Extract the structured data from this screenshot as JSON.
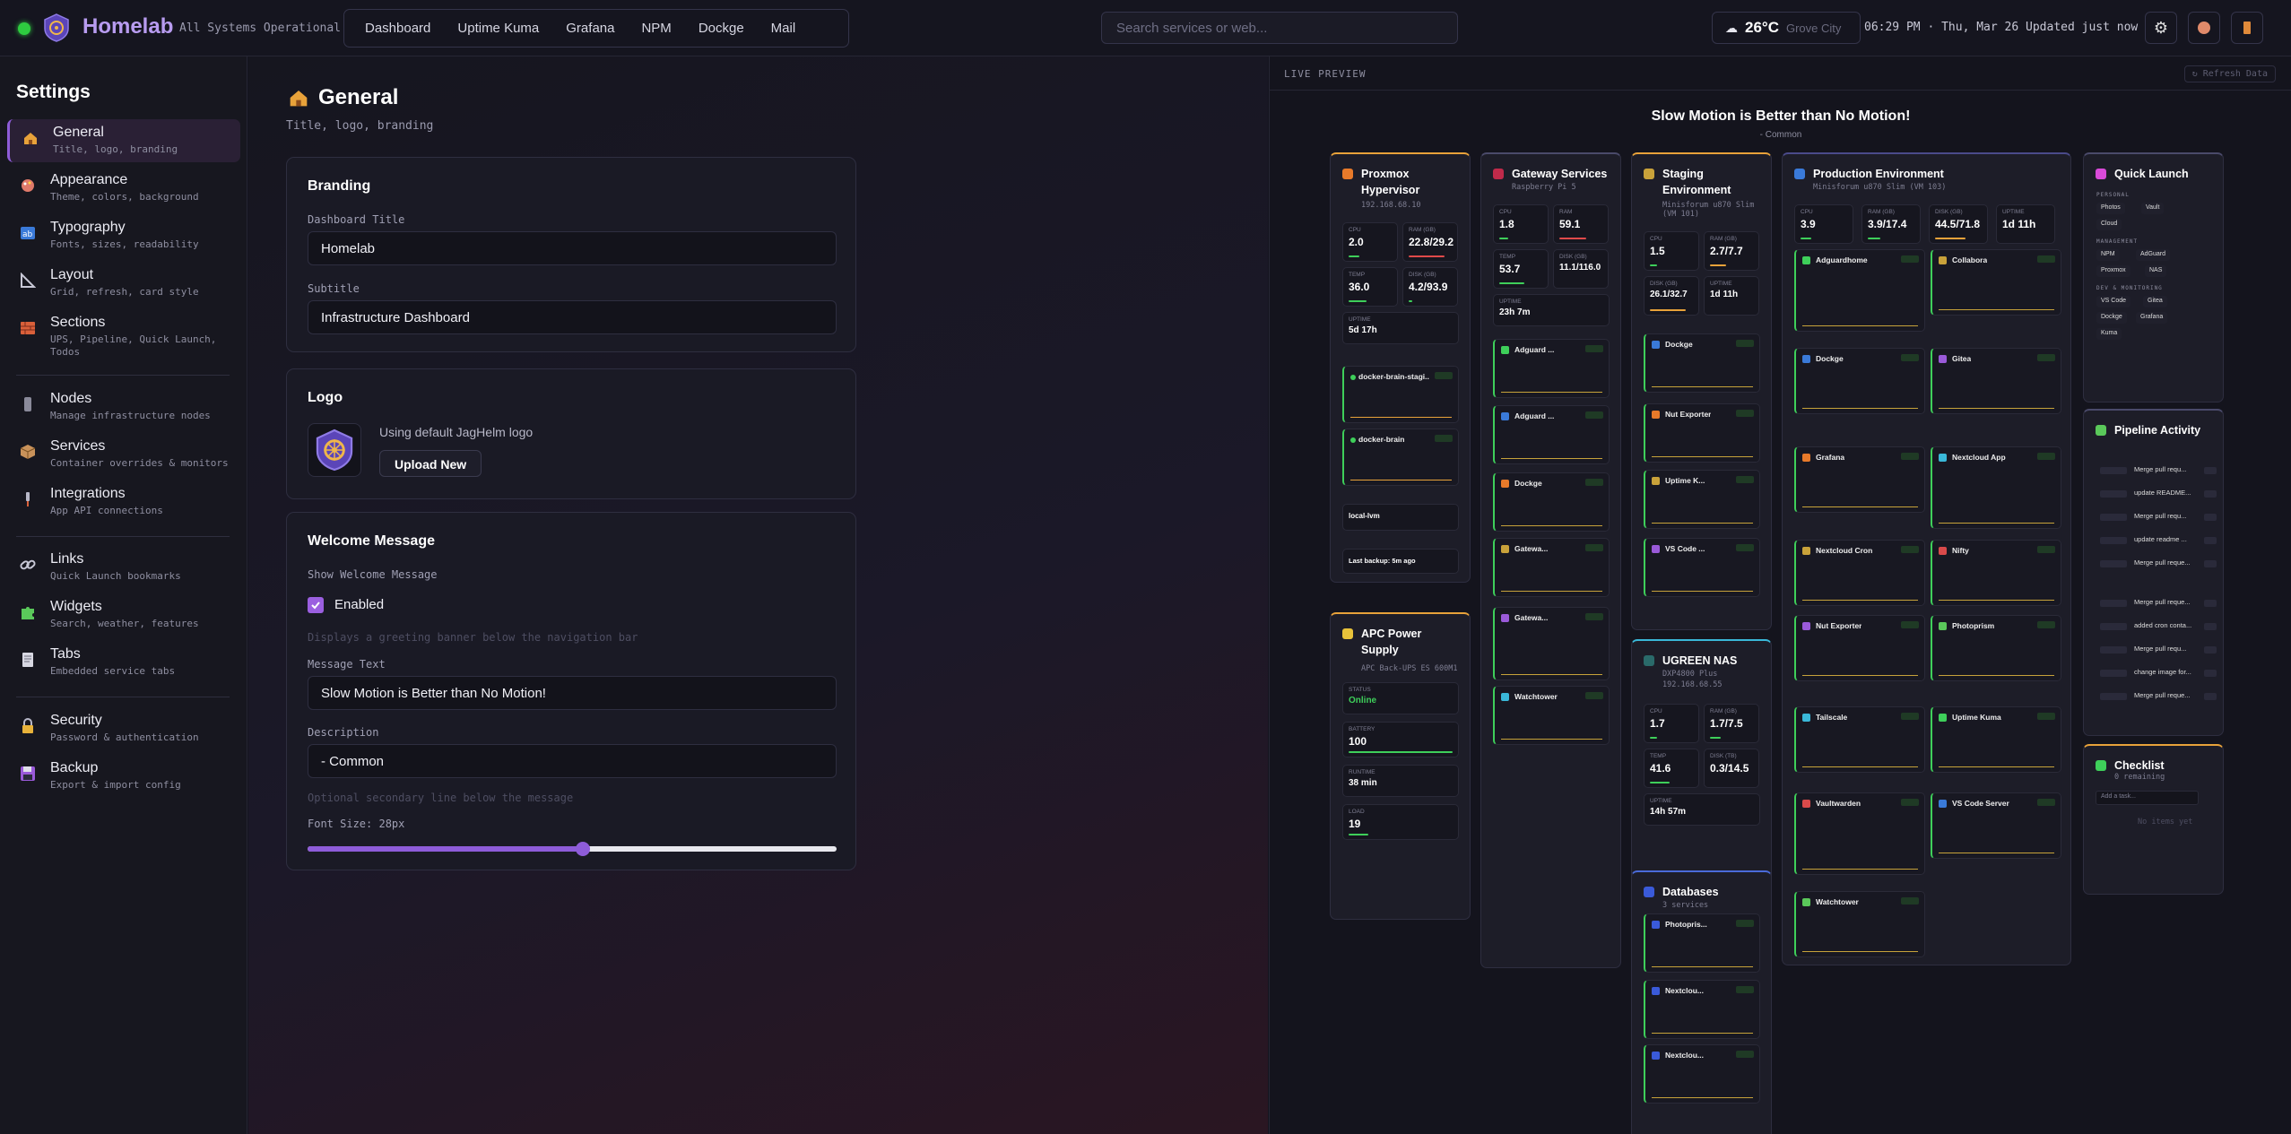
{
  "header": {
    "title": "Homelab",
    "status": "All Systems Operational",
    "nav": [
      "Dashboard",
      "Uptime Kuma",
      "Grafana",
      "NPM",
      "Dockge",
      "Mail"
    ],
    "search_placeholder": "Search services or web...",
    "weather_temp": "26°C",
    "weather_city": "Grove City",
    "clock": "06:29 PM · Thu, Mar 26  Updated just now"
  },
  "sidebar": {
    "title": "Settings",
    "items": [
      {
        "label": "General",
        "desc": "Title, logo, branding"
      },
      {
        "label": "Appearance",
        "desc": "Theme, colors, background"
      },
      {
        "label": "Typography",
        "desc": "Fonts, sizes, readability"
      },
      {
        "label": "Layout",
        "desc": "Grid, refresh, card style"
      },
      {
        "label": "Sections",
        "desc": "UPS, Pipeline, Quick Launch,",
        "desc2": "Todos"
      },
      {
        "label": "Nodes",
        "desc": "Manage infrastructure nodes"
      },
      {
        "label": "Services",
        "desc": "Container overrides & monitors"
      },
      {
        "label": "Integrations",
        "desc": "App API connections"
      },
      {
        "label": "Links",
        "desc": "Quick Launch bookmarks"
      },
      {
        "label": "Widgets",
        "desc": "Search, weather, features"
      },
      {
        "label": "Tabs",
        "desc": "Embedded service tabs"
      },
      {
        "label": "Security",
        "desc": "Password & authentication"
      },
      {
        "label": "Backup",
        "desc": "Export & import config"
      }
    ]
  },
  "main": {
    "title": "General",
    "subtitle": "Title, logo, branding",
    "branding": {
      "heading": "Branding",
      "title_label": "Dashboard Title",
      "title_value": "Homelab",
      "subtitle_label": "Subtitle",
      "subtitle_value": "Infrastructure Dashboard"
    },
    "logo": {
      "heading": "Logo",
      "text": "Using default JagHelm logo",
      "upload": "Upload New"
    },
    "welcome": {
      "heading": "Welcome Message",
      "show_label": "Show Welcome Message",
      "enabled_label": "Enabled",
      "enabled": true,
      "show_hint": "Displays a greeting banner below the navigation bar",
      "message_label": "Message Text",
      "message_value": "Slow Motion is Better than No Motion!",
      "desc_label": "Description",
      "desc_value": "- Common",
      "desc_hint": "Optional secondary line below the message",
      "font_label": "Font Size: 28px",
      "font_fraction": 0.52
    }
  },
  "preview": {
    "label": "LIVE PREVIEW",
    "refresh": "↻ Refresh Data",
    "welcome": "Slow Motion is Better than No Motion!",
    "welcome_desc": "- Common",
    "cards": {
      "proxmox": {
        "title": "Proxmox Hypervisor",
        "ip": "192.168.68.10",
        "cpu": "2.0",
        "ram": "22.8/29.2",
        "temp": "36.0",
        "disk": "4.2/93.9",
        "uptime": "5d 17h",
        "vm1": "docker-brain-stagi...",
        "vm2": "docker-brain",
        "lvm": "local-lvm",
        "backup": "Last backup: 5m ago"
      },
      "gateway": {
        "title": "Gateway Services",
        "sub": "Raspberry Pi 5",
        "cpu": "1.8",
        "ram": "59.1",
        "temp": "53.7",
        "disk": "11.1/116.0",
        "uptime": "23h 7m"
      },
      "staging": {
        "title": "Staging Environment",
        "sub": "Minisforum u870 Slim (VM 101)",
        "cpu": "1.5",
        "ram": "2.7/7.7",
        "disk": "26.1/32.7",
        "uptime": "1d 11h"
      },
      "production": {
        "title": "Production Environment",
        "sub": "Minisforum u870 Slim (VM 103)",
        "cpu": "3.9",
        "ram": "3.9/17.4",
        "disk": "44.5/71.8",
        "uptime": "1d 11h"
      },
      "quick": {
        "title": "Quick Launch",
        "personal": "PERSONAL",
        "management": "MANAGEMENT",
        "dev": "DEV & MONITORING",
        "chips": [
          "Photos",
          "Vault",
          "Cloud",
          "NPM",
          "AdGuard",
          "Proxmox",
          "NAS",
          "VS Code",
          "Gitea",
          "Dockge",
          "Grafana",
          "Kuma"
        ]
      },
      "pipeline": {
        "title": "Pipeline Activity",
        "rows": [
          "Merge pull requ...",
          "update README...",
          "Merge pull requ...",
          "update readme ...",
          "Merge pull reque...",
          "Merge pull reque...",
          "added cron conta...",
          "Merge pull requ...",
          "change image for...",
          "Merge pull reque..."
        ]
      },
      "checklist": {
        "title": "Checklist",
        "sub": "0 remaining",
        "placeholder": "Add a task...",
        "empty": "No items yet"
      },
      "apc": {
        "title": "APC Power Supply",
        "sub": "APC Back-UPS ES 600M1",
        "status": "Online",
        "battery": "100",
        "runtime": "38 min",
        "load": "19"
      },
      "nas": {
        "title": "UGREEN NAS",
        "sub": "DXP4800 Plus",
        "ip": "192.168.68.55",
        "cpu": "1.7",
        "ram": "1.7/7.5",
        "temp": "41.6",
        "disk": "0.3/14.5",
        "uptime": "14h 57m"
      },
      "databases": {
        "title": "Databases",
        "sub": "3 services"
      }
    },
    "services": {
      "gateway": [
        "Adguard ...",
        "Adguard ...",
        "Dockge",
        "Gatewa...",
        "Gatewa...",
        "Watchtower"
      ],
      "staging": [
        "Dockge",
        "Nut Exporter",
        "Uptime K...",
        "VS Code ..."
      ],
      "prod_left": [
        "Adguardhome",
        "Dockge",
        "Grafana",
        "Nextcloud Cron",
        "Nut Exporter",
        "Tailscale",
        "Vaultwarden",
        "Watchtower"
      ],
      "prod_right": [
        "Collabora",
        "Gitea",
        "Nextcloud App",
        "Nifty",
        "Photoprism",
        "Uptime Kuma",
        "VS Code Server"
      ],
      "db": [
        "Photopris...",
        "Nextclou...",
        "Nextclou..."
      ]
    }
  }
}
